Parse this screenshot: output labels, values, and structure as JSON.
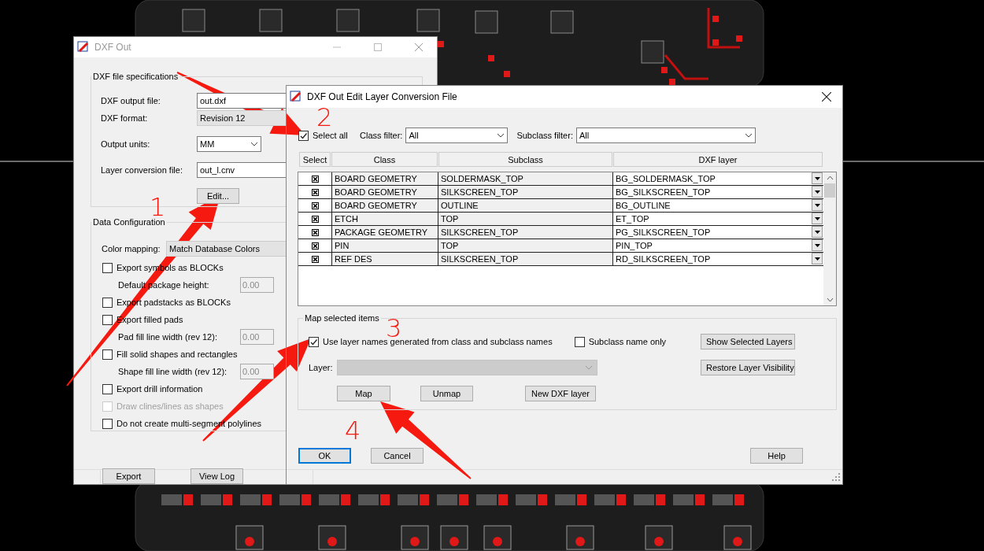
{
  "dxf_out": {
    "title": "DXF Out",
    "file_spec": {
      "title": "DXF file specifications",
      "fields": [
        {
          "kind": "input",
          "label": "DXF output file:",
          "value": "out.dxf"
        },
        {
          "kind": "readonly",
          "label": "DXF format:",
          "value": "Revision 12"
        },
        {
          "kind": "select",
          "label": "Output units:",
          "value": "MM"
        },
        {
          "kind": "input",
          "label": "Layer conversion file:",
          "value": "out_l.cnv"
        }
      ],
      "edit_button": "Edit..."
    },
    "data_config": {
      "title": "Data Configuration",
      "color_mapping": {
        "label": "Color mapping:",
        "value": "Match Database Colors"
      },
      "options": [
        {
          "kind": "checkbox",
          "label": "Export symbols as BLOCKs",
          "checked": false,
          "disabled": false
        },
        {
          "kind": "number",
          "label": "Default package height:",
          "value": "0.00"
        },
        {
          "kind": "checkbox",
          "label": "Export padstacks as BLOCKs",
          "checked": false,
          "disabled": false
        },
        {
          "kind": "checkbox",
          "label": "Export filled pads",
          "checked": false,
          "disabled": false
        },
        {
          "kind": "number",
          "label": "Pad fill line width (rev 12):",
          "value": "0.00"
        },
        {
          "kind": "checkbox",
          "label": "Fill solid shapes and rectangles",
          "checked": false,
          "disabled": false
        },
        {
          "kind": "number",
          "label": "Shape fill line width (rev 12):",
          "value": "0.00"
        },
        {
          "kind": "checkbox",
          "label": "Export drill information",
          "checked": false,
          "disabled": false
        },
        {
          "kind": "checkbox",
          "label": "Draw clines/lines as shapes",
          "checked": false,
          "disabled": true
        },
        {
          "kind": "checkbox",
          "label": "Do not create multi-segment polylines",
          "checked": false,
          "disabled": false
        }
      ]
    },
    "buttons": [
      "Export",
      "View Log"
    ]
  },
  "edit_layer": {
    "title": "DXF Out Edit Layer Conversion File",
    "select_all": {
      "label": "Select all",
      "checked": true
    },
    "class_filter": {
      "label": "Class filter:",
      "value": "All"
    },
    "subclass_filter": {
      "label": "Subclass filter:",
      "value": "All"
    },
    "columns": [
      "Select",
      "Class",
      "Subclass",
      "DXF layer"
    ],
    "rows": [
      {
        "checked": true,
        "class": "BOARD GEOMETRY",
        "subclass": "SOLDERMASK_TOP",
        "layer": "BG_SOLDERMASK_TOP"
      },
      {
        "checked": true,
        "class": "BOARD GEOMETRY",
        "subclass": "SILKSCREEN_TOP",
        "layer": "BG_SILKSCREEN_TOP"
      },
      {
        "checked": true,
        "class": "BOARD GEOMETRY",
        "subclass": "OUTLINE",
        "layer": "BG_OUTLINE"
      },
      {
        "checked": true,
        "class": "ETCH",
        "subclass": "TOP",
        "layer": "ET_TOP"
      },
      {
        "checked": true,
        "class": "PACKAGE GEOMETRY",
        "subclass": "SILKSCREEN_TOP",
        "layer": "PG_SILKSCREEN_TOP"
      },
      {
        "checked": true,
        "class": "PIN",
        "subclass": "TOP",
        "layer": "PIN_TOP"
      },
      {
        "checked": true,
        "class": "REF DES",
        "subclass": "SILKSCREEN_TOP",
        "layer": "RD_SILKSCREEN_TOP"
      }
    ],
    "map_group": {
      "title": "Map selected items",
      "use_generated": {
        "label": "Use layer names generated from class and subclass names",
        "checked": true
      },
      "subclass_only": {
        "label": "Subclass name only",
        "checked": false
      },
      "layer_label": "Layer:",
      "buttons": [
        "Map",
        "Unmap",
        "New DXF layer"
      ],
      "side_buttons": [
        "Show Selected Layers",
        "Restore Layer Visibility"
      ]
    },
    "footer_buttons": [
      {
        "label": "OK",
        "default": true
      },
      {
        "label": "Cancel",
        "default": false
      },
      {
        "label": "Help",
        "default": false
      }
    ]
  },
  "annotations": [
    "1",
    "2",
    "3",
    "4"
  ]
}
